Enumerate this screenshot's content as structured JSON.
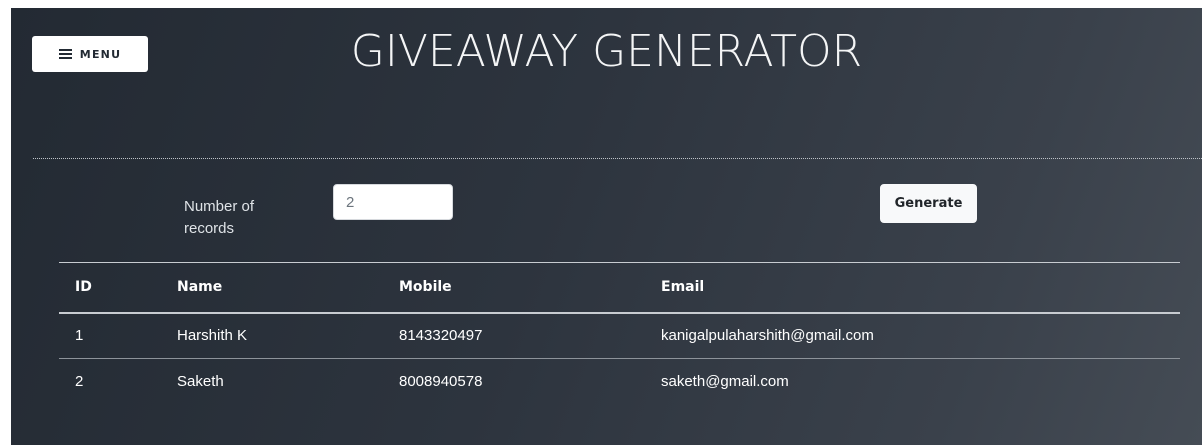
{
  "header": {
    "menu_label": "MENU",
    "menu_icon": "hamburger-icon",
    "title": "GIVEAWAY GENERATOR"
  },
  "form": {
    "records_label": "Number of records",
    "records_value": "2",
    "generate_label": "Generate"
  },
  "table": {
    "columns": [
      "ID",
      "Name",
      "Mobile",
      "Email"
    ],
    "rows": [
      {
        "id": "1",
        "name": "Harshith K",
        "mobile": "8143320497",
        "email": "kanigalpulaharshith@gmail.com"
      },
      {
        "id": "2",
        "name": "Saketh",
        "mobile": "8008940578",
        "email": "saketh@gmail.com"
      }
    ]
  },
  "colors": {
    "background_dark": "#2d343e",
    "button_light": "#f8f9fa",
    "text": "#ffffff"
  }
}
